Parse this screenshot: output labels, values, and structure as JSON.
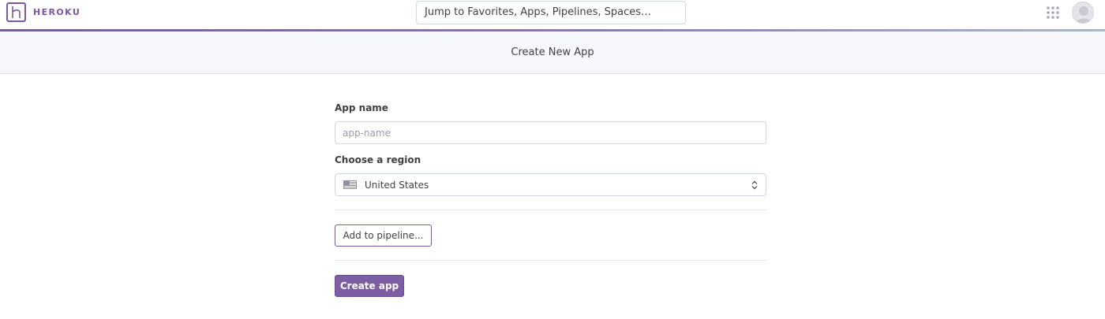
{
  "header": {
    "logo_text": "HEROKU",
    "search_placeholder": "Jump to Favorites, Apps, Pipelines, Spaces…",
    "icons": [
      "heroku-logo-icon",
      "apps-grid-icon",
      "avatar"
    ]
  },
  "subheader": {
    "title": "Create New App"
  },
  "form": {
    "app_name_label": "App name",
    "app_name_placeholder": "app-name",
    "app_name_value": "",
    "region_label": "Choose a region",
    "region_value": "United States",
    "region_icon": "us-flag-icon",
    "add_pipeline_label": "Add to pipeline...",
    "create_label": "Create app"
  },
  "colors": {
    "brand": "#79589f",
    "primary_button": "#7d5ea5",
    "subheader_bg": "#f7f8fb"
  }
}
